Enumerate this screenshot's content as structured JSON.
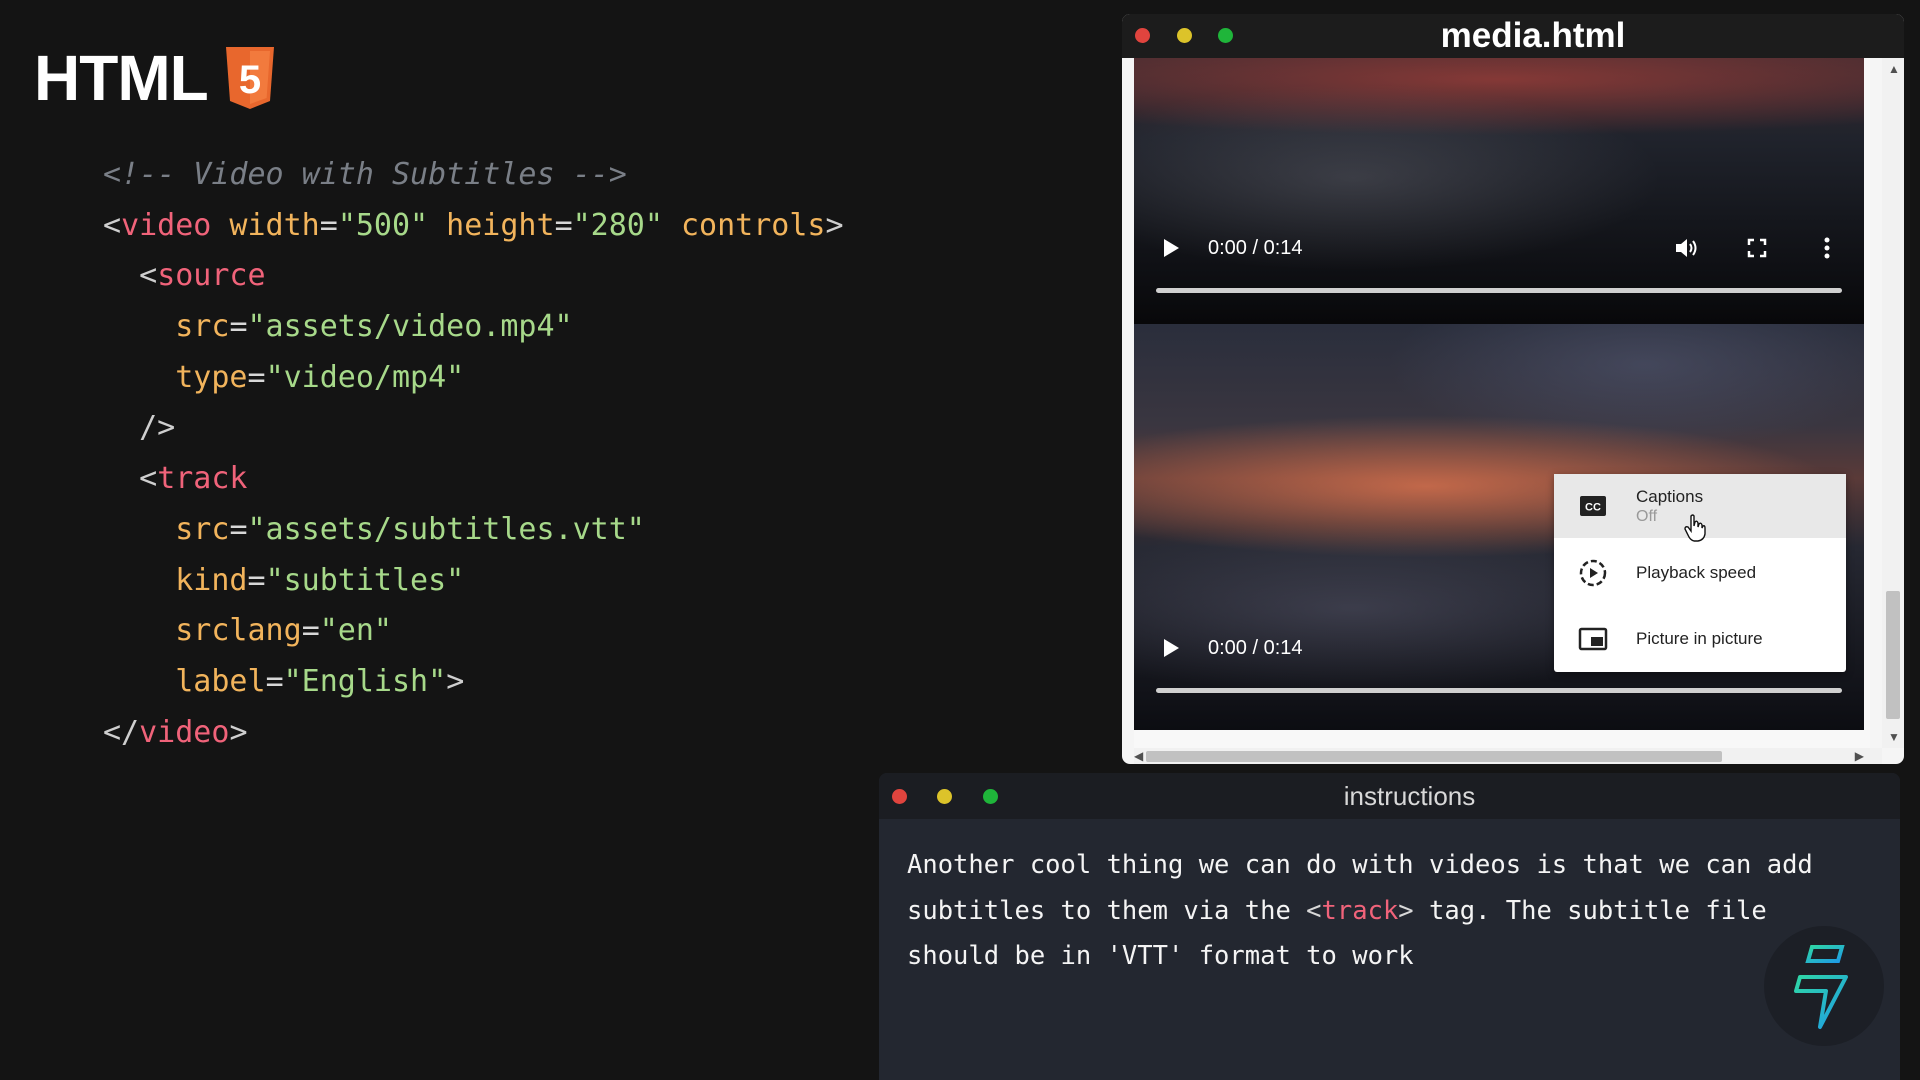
{
  "brand": {
    "title": "HTML",
    "badge_digit": "5",
    "badge_color": "#e8672d"
  },
  "code_lines": [
    [
      {
        "t": "<!-- Video with Subtitles -->",
        "c": "c-comment"
      }
    ],
    [
      {
        "t": "<",
        "c": "c-punc"
      },
      {
        "t": "video",
        "c": "c-tag"
      },
      {
        "t": " width",
        "c": "c-attr"
      },
      {
        "t": "=",
        "c": "c-eq"
      },
      {
        "t": "\"500\"",
        "c": "c-str"
      },
      {
        "t": " height",
        "c": "c-attr"
      },
      {
        "t": "=",
        "c": "c-eq"
      },
      {
        "t": "\"280\"",
        "c": "c-str"
      },
      {
        "t": " controls",
        "c": "c-attr"
      },
      {
        "t": ">",
        "c": "c-punc"
      }
    ],
    [
      {
        "t": "  <",
        "c": "c-punc"
      },
      {
        "t": "source",
        "c": "c-tag"
      }
    ],
    [
      {
        "t": "    src",
        "c": "c-attr"
      },
      {
        "t": "=",
        "c": "c-eq"
      },
      {
        "t": "\"assets/video.mp4\"",
        "c": "c-str"
      }
    ],
    [
      {
        "t": "    type",
        "c": "c-attr"
      },
      {
        "t": "=",
        "c": "c-eq"
      },
      {
        "t": "\"video/mp4\"",
        "c": "c-str"
      }
    ],
    [
      {
        "t": "  />",
        "c": "c-punc"
      }
    ],
    [
      {
        "t": "  <",
        "c": "c-punc"
      },
      {
        "t": "track",
        "c": "c-tag"
      }
    ],
    [
      {
        "t": "    src",
        "c": "c-attr"
      },
      {
        "t": "=",
        "c": "c-eq"
      },
      {
        "t": "\"assets/subtitles.vtt\"",
        "c": "c-str"
      }
    ],
    [
      {
        "t": "    kind",
        "c": "c-attr"
      },
      {
        "t": "=",
        "c": "c-eq"
      },
      {
        "t": "\"subtitles\"",
        "c": "c-str"
      }
    ],
    [
      {
        "t": "    srclang",
        "c": "c-attr"
      },
      {
        "t": "=",
        "c": "c-eq"
      },
      {
        "t": "\"en\"",
        "c": "c-str"
      }
    ],
    [
      {
        "t": "    label",
        "c": "c-attr"
      },
      {
        "t": "=",
        "c": "c-eq"
      },
      {
        "t": "\"English\"",
        "c": "c-str"
      },
      {
        "t": ">",
        "c": "c-punc"
      }
    ],
    [
      {
        "t": "</",
        "c": "c-punc"
      },
      {
        "t": "video",
        "c": "c-tag"
      },
      {
        "t": ">",
        "c": "c-punc"
      }
    ]
  ],
  "browser": {
    "title": "media.html",
    "videos": [
      {
        "time": "0:00 / 0:14",
        "progress": 0
      },
      {
        "time": "0:00 / 0:14",
        "progress": 0
      }
    ],
    "menu": [
      {
        "label": "Captions",
        "sub": "Off",
        "icon": "cc-icon"
      },
      {
        "label": "Playback speed",
        "icon": "playback-speed-icon"
      },
      {
        "label": "Picture in picture",
        "icon": "picture-in-picture-icon"
      }
    ]
  },
  "instructions": {
    "title": "instructions",
    "text_before": "Another cool thing we can do with videos is that we can add subtitles to them via the ",
    "tag_open": "<",
    "tag_name": "track",
    "tag_close": ">",
    "text_after": " tag. The subtitle file should be in 'VTT' format to work"
  }
}
